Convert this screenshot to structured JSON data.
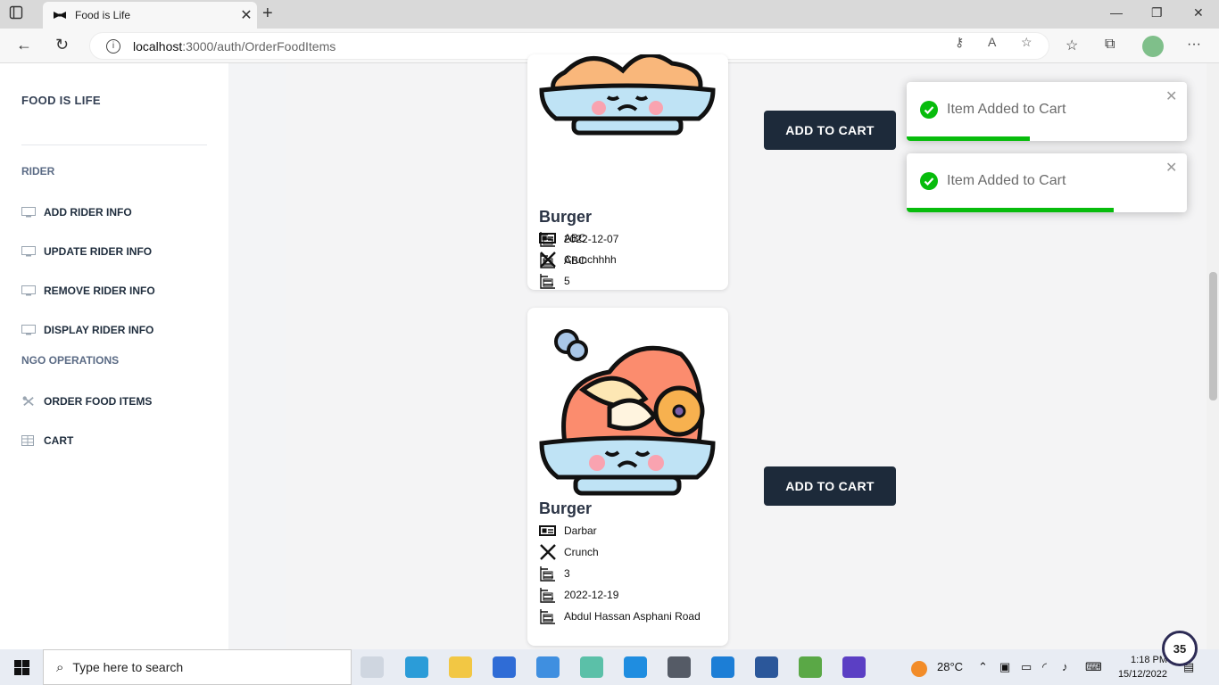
{
  "browser": {
    "tab_title": "Food is Life",
    "url_host": "localhost",
    "url_path": ":3000/auth/OrderFoodItems"
  },
  "sidebar": {
    "brand": "FOOD IS LIFE",
    "sections": [
      {
        "label": "RIDER"
      },
      {
        "label": "NGO OPERATIONS"
      }
    ],
    "items": [
      {
        "label": "ADD RIDER INFO",
        "icon": "monitor-icon"
      },
      {
        "label": "UPDATE RIDER INFO",
        "icon": "monitor-icon"
      },
      {
        "label": "REMOVE RIDER INFO",
        "icon": "monitor-icon"
      },
      {
        "label": "DISPLAY RIDER INFO",
        "icon": "monitor-icon"
      },
      {
        "label": "ORDER FOOD ITEMS",
        "icon": "tools-icon"
      },
      {
        "label": "CART",
        "icon": "table-icon"
      }
    ]
  },
  "cards": [
    {
      "title": "Burger",
      "provider": "ABC",
      "description": "Crunchhhh",
      "quantity": "5",
      "date": "2022-12-07",
      "address": "ABC",
      "button": "ADD TO CART"
    },
    {
      "title": "Burger",
      "provider": "Darbar",
      "description": "Crunch",
      "quantity": "3",
      "date": "2022-12-19",
      "address": "Abdul Hassan Asphani Road",
      "button": "ADD TO CART"
    }
  ],
  "toasts": [
    {
      "message": "Item Added to Cart",
      "progress": 0.44
    },
    {
      "message": "Item Added to Cart",
      "progress": 0.74
    }
  ],
  "taskbar": {
    "search_placeholder": "Type here to search",
    "weather": "28°C",
    "time": "1:18 PM",
    "date": "15/12/2022",
    "badge": "35"
  },
  "colors": {
    "accent_dark": "#1d2a3a",
    "toast_success": "#07bc0c"
  }
}
